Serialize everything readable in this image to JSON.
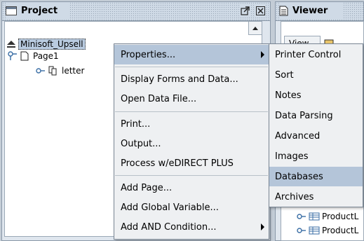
{
  "project_panel": {
    "title": "Project",
    "tree": [
      {
        "label": "Minisoft_Upsell",
        "icon": "eject-icon"
      },
      {
        "label": "Page1",
        "icon": "page-icon"
      },
      {
        "label": "letter",
        "icon": "copy-icon"
      }
    ]
  },
  "viewer_panel": {
    "title": "Viewer",
    "toolbar_label": "View",
    "rows": [
      {
        "label": "ProductL"
      },
      {
        "label": "ProductL"
      }
    ]
  },
  "context_menu": {
    "items": [
      {
        "label": "Properties...",
        "has_submenu": true
      },
      {
        "label": "Display Forms and Data..."
      },
      {
        "label": "Open Data File..."
      },
      {
        "label": "Print..."
      },
      {
        "label": "Output..."
      },
      {
        "label": "Process w/eDIRECT PLUS"
      },
      {
        "label": "Add Page..."
      },
      {
        "label": "Add Global Variable..."
      },
      {
        "label": "Add AND Condition...",
        "has_submenu": true
      }
    ]
  },
  "properties_submenu": {
    "items": [
      {
        "label": "Printer Control"
      },
      {
        "label": "Sort"
      },
      {
        "label": "Notes"
      },
      {
        "label": "Data Parsing"
      },
      {
        "label": "Advanced"
      },
      {
        "label": "Images"
      },
      {
        "label": "Databases"
      },
      {
        "label": "Archives"
      }
    ]
  },
  "colors": {
    "highlight": "#b4c5d9",
    "panel_bg": "#dfe6ee",
    "menu_bg": "#eef0f2"
  }
}
